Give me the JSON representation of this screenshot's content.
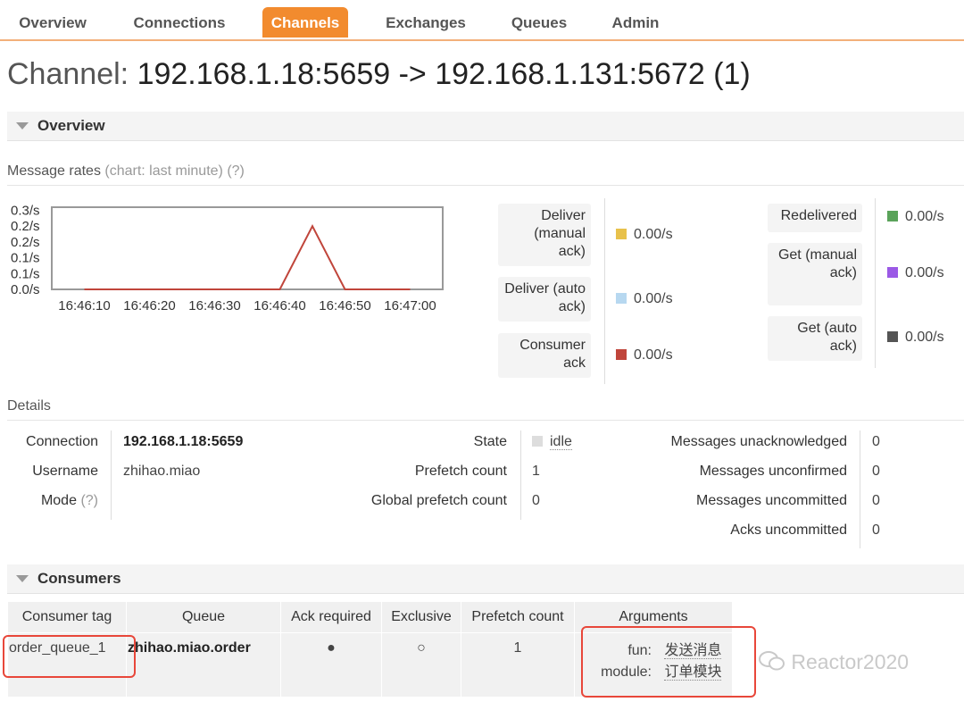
{
  "nav": {
    "tabs": [
      "Overview",
      "Connections",
      "Channels",
      "Exchanges",
      "Queues",
      "Admin"
    ],
    "active": "Channels"
  },
  "title": {
    "prefix": "Channel:",
    "name": "192.168.1.18:5659 -> 192.168.1.131:5672 (1)"
  },
  "overview": {
    "heading": "Overview",
    "rates_label": "Message rates",
    "rates_hint": "(chart: last minute) (?)",
    "chart_data": {
      "type": "line",
      "ytick_labels": [
        "0.3/s",
        "0.2/s",
        "0.2/s",
        "0.1/s",
        "0.1/s",
        "0.0/s"
      ],
      "yticks": [
        0.25,
        0.2,
        0.15,
        0.1,
        0.05,
        0.0
      ],
      "ylim": [
        0,
        0.26
      ],
      "x": [
        "16:46:10",
        "16:46:20",
        "16:46:30",
        "16:46:40",
        "16:46:50",
        "16:47:00"
      ],
      "series": [
        {
          "color": "#c0453b",
          "points": [
            {
              "x": "16:46:10",
              "y": 0
            },
            {
              "x": "16:46:40",
              "y": 0
            },
            {
              "x": "16:46:45",
              "y": 0.2
            },
            {
              "x": "16:46:50",
              "y": 0
            },
            {
              "x": "16:47:00",
              "y": 0
            }
          ]
        }
      ]
    },
    "rates_left": [
      {
        "label": "Deliver (manual ack)",
        "value": "0.00/s",
        "color": "#e8c14b"
      },
      {
        "label": "Deliver (auto ack)",
        "value": "0.00/s",
        "color": "#b7d8f0"
      },
      {
        "label": "Consumer ack",
        "value": "0.00/s",
        "color": "#c0453b"
      }
    ],
    "rates_right": [
      {
        "label": "Redelivered",
        "value": "0.00/s",
        "color": "#5aa35a"
      },
      {
        "label": "Get (manual ack)",
        "value": "0.00/s",
        "color": "#9b59e6"
      },
      {
        "label": "Get (auto ack)",
        "value": "0.00/s",
        "color": "#555555"
      }
    ]
  },
  "details": {
    "heading": "Details",
    "connection_label": "Connection",
    "connection": "192.168.1.18:5659",
    "username_label": "Username",
    "username": "zhihao.miao",
    "mode_label": "Mode",
    "mode_hint": "(?)",
    "state_label": "State",
    "state": "idle",
    "prefetch_label": "Prefetch count",
    "prefetch": "1",
    "global_prefetch_label": "Global prefetch count",
    "global_prefetch": "0",
    "msg_unacked_label": "Messages unacknowledged",
    "msg_unacked": "0",
    "msg_unconfirmed_label": "Messages unconfirmed",
    "msg_unconfirmed": "0",
    "msg_uncommitted_label": "Messages uncommitted",
    "msg_uncommitted": "0",
    "acks_uncommitted_label": "Acks uncommitted",
    "acks_uncommitted": "0"
  },
  "consumers": {
    "heading": "Consumers",
    "columns": [
      "Consumer tag",
      "Queue",
      "Ack required",
      "Exclusive",
      "Prefetch count",
      "Arguments"
    ],
    "row": {
      "tag": "order_queue_1",
      "queue": "zhihao.miao.order",
      "ack_required": "●",
      "exclusive": "○",
      "prefetch": "1",
      "args": [
        {
          "key": "fun:",
          "value": "发送消息"
        },
        {
          "key": "module:",
          "value": "订单模块"
        }
      ]
    }
  },
  "watermark": "Reactor2020"
}
